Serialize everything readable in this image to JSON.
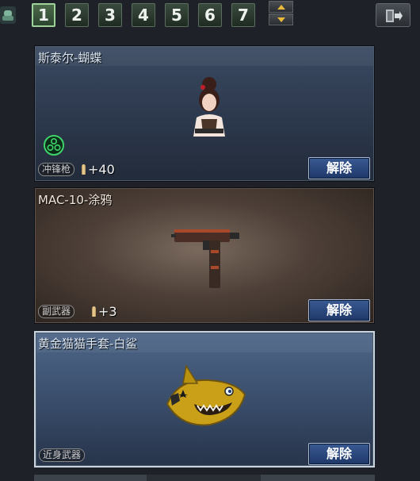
{
  "tabs": [
    "1",
    "2",
    "3",
    "4",
    "5",
    "6",
    "7"
  ],
  "active_tab": "1",
  "items": [
    {
      "title": "斯泰尔-蝴蝶",
      "category": "冲锋枪",
      "bonus": "+40",
      "release_label": "解除"
    },
    {
      "title": "MAC-10-涂鸦",
      "category": "副武器",
      "bonus": "+3",
      "release_label": "解除"
    },
    {
      "title": "黄金猫猫手套-白鲨",
      "category": "近身武器",
      "release_label": "解除"
    }
  ],
  "icons": {
    "left": "character-icon",
    "exit": "exit-door-icon",
    "scroll_up": "arrow-up-icon",
    "scroll_down": "arrow-down-icon",
    "slot": "green-dots-icon"
  },
  "colors": {
    "tab_active_border": "#9fd19a",
    "release_button": "#2a4a82",
    "arrow": "#e8b93a",
    "slot_icon": "#3fd36a"
  }
}
